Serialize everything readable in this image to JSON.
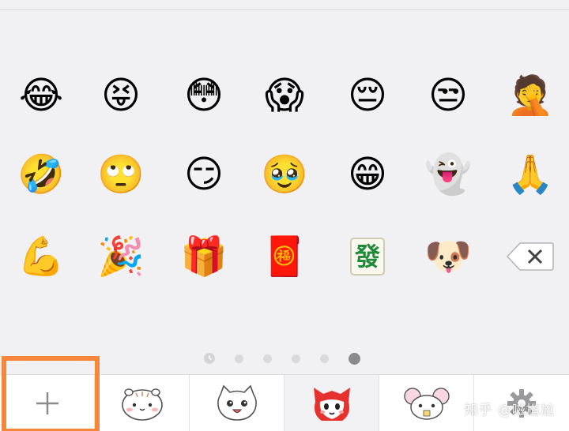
{
  "emoji_rows": [
    [
      {
        "name": "face-with-tears-of-joy-icon",
        "char": "😂"
      },
      {
        "name": "squinting-face-with-tongue-icon",
        "char": "😝"
      },
      {
        "name": "flushed-face-icon",
        "char": "😳"
      },
      {
        "name": "face-screaming-in-fear-icon",
        "char": "😱"
      },
      {
        "name": "pensive-face-icon",
        "char": "😔"
      },
      {
        "name": "unamused-face-icon",
        "char": "😒"
      },
      {
        "name": "facepalm-face-icon",
        "char": "🤦"
      }
    ],
    [
      {
        "name": "covering-face-laughing-icon",
        "char": "🤣"
      },
      {
        "name": "side-eye-smile-icon",
        "char": "🙄"
      },
      {
        "name": "smirking-thinking-face-icon",
        "char": "😏"
      },
      {
        "name": "shy-face-icon",
        "char": "🥹"
      },
      {
        "name": "peace-sign-face-icon",
        "char": "😁"
      },
      {
        "name": "ghost-icon",
        "char": "👻"
      },
      {
        "name": "folded-hands-icon",
        "char": "🙏"
      }
    ],
    [
      {
        "name": "flexed-biceps-icon",
        "char": "💪"
      },
      {
        "name": "party-popper-icon",
        "char": "🎉"
      },
      {
        "name": "gift-icon",
        "char": "🎁"
      },
      {
        "name": "red-envelope-icon",
        "char": "🧧"
      },
      {
        "name": "mahjong-fa-tile-icon",
        "char": "發"
      },
      {
        "name": "white-dog-icon",
        "char": "🐶"
      }
    ]
  ],
  "page_dots": {
    "count": 6,
    "active_index": 5
  },
  "toolbar": {
    "add_label": "+",
    "stickers": [
      {
        "name": "sticker-pack-hamster-icon",
        "char": "🐹"
      },
      {
        "name": "sticker-pack-cat-icon",
        "char": "🐱"
      },
      {
        "name": "sticker-pack-fox-icon",
        "char": "🦊"
      },
      {
        "name": "sticker-pack-mouse-icon",
        "char": "🐭"
      }
    ]
  },
  "watermark": "知乎 @嗞尴尬"
}
